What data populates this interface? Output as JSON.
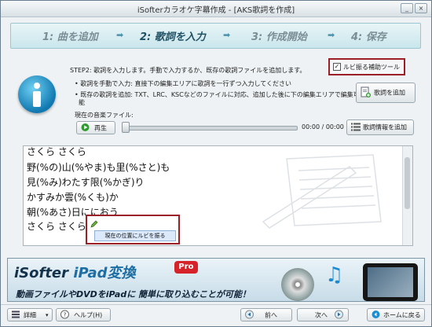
{
  "window": {
    "title": "iSofterカラオケ字幕作成 - [AKS歌詞を作成]",
    "minimize": "_",
    "close": "×"
  },
  "steps": [
    {
      "label": "1: 曲を追加",
      "active": false
    },
    {
      "label": "2: 歌詞を入力",
      "active": true
    },
    {
      "label": "3: 作成開始",
      "active": false
    },
    {
      "label": "4: 保存",
      "active": false
    }
  ],
  "step_arrow": "➡",
  "info": {
    "step_text": "STEP2: 歌詞を入力します。手動で入力するか、既存の歌詞ファイルを追加します。",
    "bullet1": "• 歌詞を手動で入力: 直接下の編集エリアに歌詞を一行ずつ入力してください",
    "bullet2a": "• 既存の歌詞を追加: TXT、LRC、KSCなどのファイルに対応、追加した後に下の編集エリアで編集可",
    "bullet2b": "能",
    "current_music_label": "現在の音楽ファイル:",
    "ruby_tool_label": "ルビ振る補助ツール",
    "ruby_tool_checked": "✓"
  },
  "buttons": {
    "add_lyrics": "歌詞を追加",
    "play": "再生",
    "add_lyric_info": "歌詞情報を追加",
    "details": "詳細",
    "help": "ヘルプ(H)",
    "prev": "前へ",
    "next": "次へ",
    "home": "ホームに戻る"
  },
  "player": {
    "time": "00:00 / 00:00",
    "progress": 0
  },
  "lyrics": [
    "さくら さくら",
    "野(%の)山(%やま)も里(%さと)も",
    "見(%み)わたす限(%かぎ)り",
    "かすみか雲(%くも)か",
    "朝(%あさ)日ににおう",
    "さくら さくら"
  ],
  "context_menu": {
    "item": "現在の位置にルビを振る"
  },
  "banner": {
    "brand_prefix": "iSofter",
    "brand_product": "iPad変換",
    "pro": "Pro",
    "tagline": "動画ファイルやDVDをiPadに 簡単に取り込むことが可能！"
  },
  "colors": {
    "highlight_border": "#9c1e27",
    "play_green": "#2f9b2f",
    "accent_blue": "#1e4f63"
  }
}
